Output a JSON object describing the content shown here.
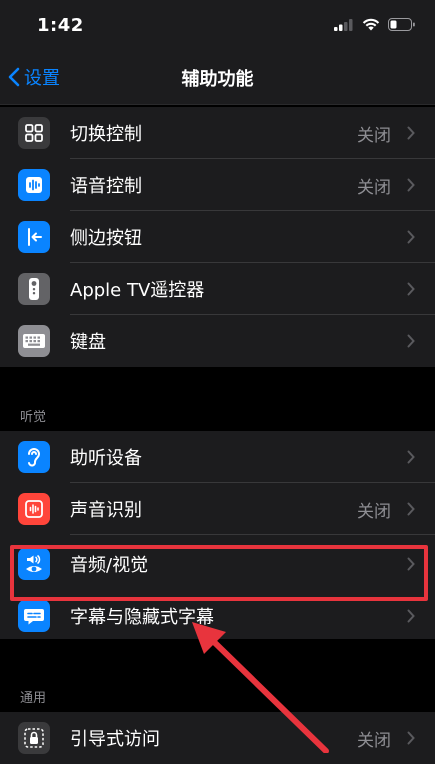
{
  "status": {
    "time": "1:42"
  },
  "nav": {
    "back_label": "设置",
    "title": "辅助功能"
  },
  "group1": [
    {
      "label": "切换控制",
      "value": "关闭",
      "icon": "switch-control-icon",
      "color": "#3a3a3c"
    },
    {
      "label": "语音控制",
      "value": "关闭",
      "icon": "voice-control-icon",
      "color": "#0a84ff"
    },
    {
      "label": "侧边按钮",
      "value": "",
      "icon": "side-button-icon",
      "color": "#0a84ff"
    },
    {
      "label": "Apple TV遥控器",
      "value": "",
      "icon": "tv-remote-icon",
      "color": "#636366"
    },
    {
      "label": "键盘",
      "value": "",
      "icon": "keyboard-icon",
      "color": "#8e8e93"
    }
  ],
  "section_hearing": "听觉",
  "group2": [
    {
      "label": "助听设备",
      "value": "",
      "icon": "hearing-devices-icon",
      "color": "#0a84ff"
    },
    {
      "label": "声音识别",
      "value": "关闭",
      "icon": "sound-recognition-icon",
      "color": "#ff453a"
    },
    {
      "label": "音频/视觉",
      "value": "",
      "icon": "audio-visual-icon",
      "color": "#0a84ff"
    },
    {
      "label": "字幕与隐藏式字幕",
      "value": "",
      "icon": "subtitles-icon",
      "color": "#0a84ff"
    }
  ],
  "section_general": "通用",
  "group3": [
    {
      "label": "引导式访问",
      "value": "关闭",
      "icon": "guided-access-icon",
      "color": "#3a3a3c"
    }
  ]
}
